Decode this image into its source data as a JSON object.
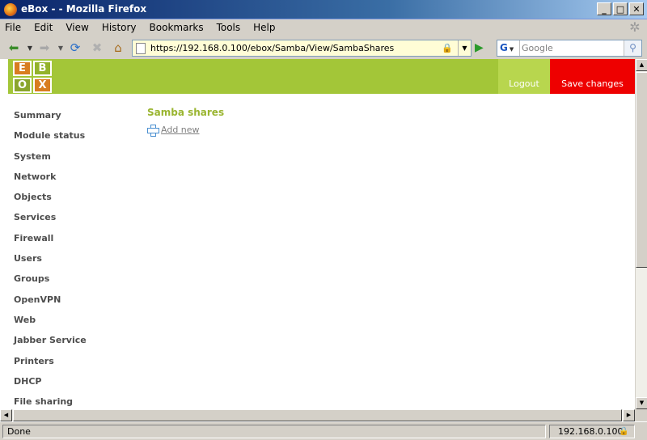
{
  "window": {
    "title": "eBox - - Mozilla Firefox"
  },
  "menubar": [
    "File",
    "Edit",
    "View",
    "History",
    "Bookmarks",
    "Tools",
    "Help"
  ],
  "navbar": {
    "url": "https://192.168.0.100/ebox/Samba/View/SambaShares",
    "search_placeholder": "Google",
    "search_engine": "G"
  },
  "header": {
    "logo_letters": [
      "E",
      "B",
      "O",
      "X"
    ],
    "logout_label": "Logout",
    "save_label": "Save changes",
    "colors": {
      "bar": "#a3c638",
      "save": "#ee0000",
      "logout": "#b8d64e"
    }
  },
  "sidebar": {
    "items": [
      "Summary",
      "Module status",
      "System",
      "Network",
      "Objects",
      "Services",
      "Firewall",
      "Users",
      "Groups",
      "OpenVPN",
      "Web",
      "Jabber Service",
      "Printers",
      "DHCP",
      "File sharing"
    ]
  },
  "main": {
    "title": "Samba shares",
    "add_new_label": "Add new"
  },
  "status": {
    "text": "Done",
    "host": "192.168.0.100"
  }
}
